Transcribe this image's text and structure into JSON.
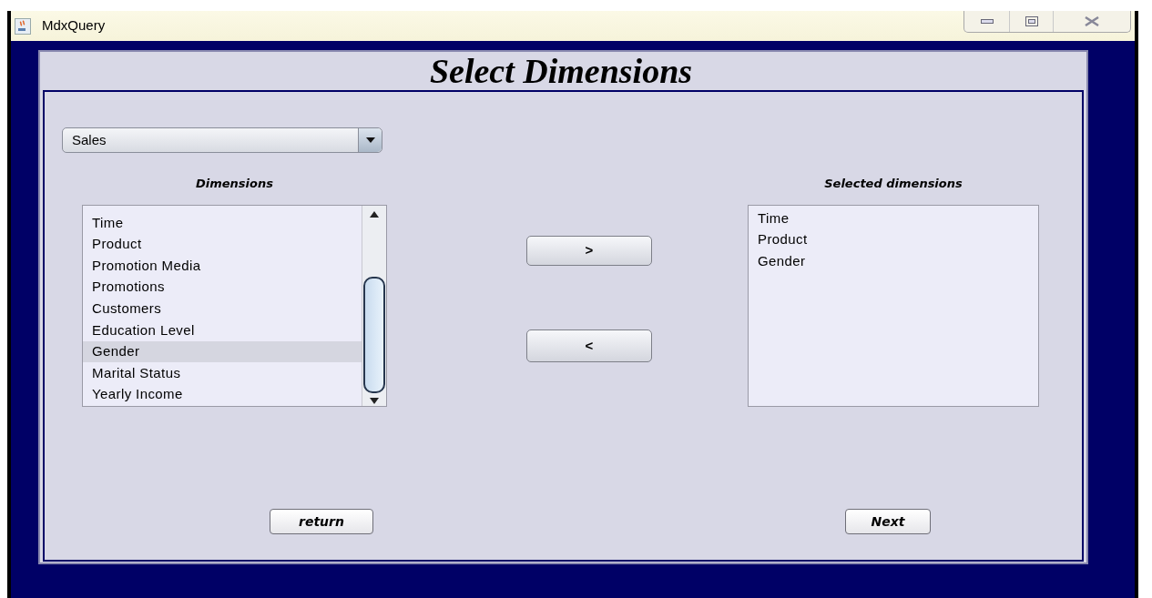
{
  "window": {
    "title": "MdxQuery"
  },
  "heading": "Select Dimensions",
  "cube_select": {
    "value": "Sales"
  },
  "dimensions": {
    "label": "Dimensions",
    "items": [
      {
        "text": "Time",
        "selected": false
      },
      {
        "text": "Product",
        "selected": false
      },
      {
        "text": "Promotion Media",
        "selected": false
      },
      {
        "text": "Promotions",
        "selected": false
      },
      {
        "text": "Customers",
        "selected": false
      },
      {
        "text": "Education Level",
        "selected": false
      },
      {
        "text": "Gender",
        "selected": true
      },
      {
        "text": "Marital Status",
        "selected": false
      },
      {
        "text": "Yearly Income",
        "selected": false
      }
    ]
  },
  "move_buttons": [
    {
      "label": ">"
    },
    {
      "label": "<"
    }
  ],
  "selected_dimensions": {
    "label": "Selected dimensions",
    "items": [
      {
        "text": "Time",
        "selected": false
      },
      {
        "text": "Product",
        "selected": false
      },
      {
        "text": "Gender",
        "selected": false
      }
    ]
  },
  "buttons": [
    {
      "label": "return"
    },
    {
      "label": "Next"
    }
  ]
}
